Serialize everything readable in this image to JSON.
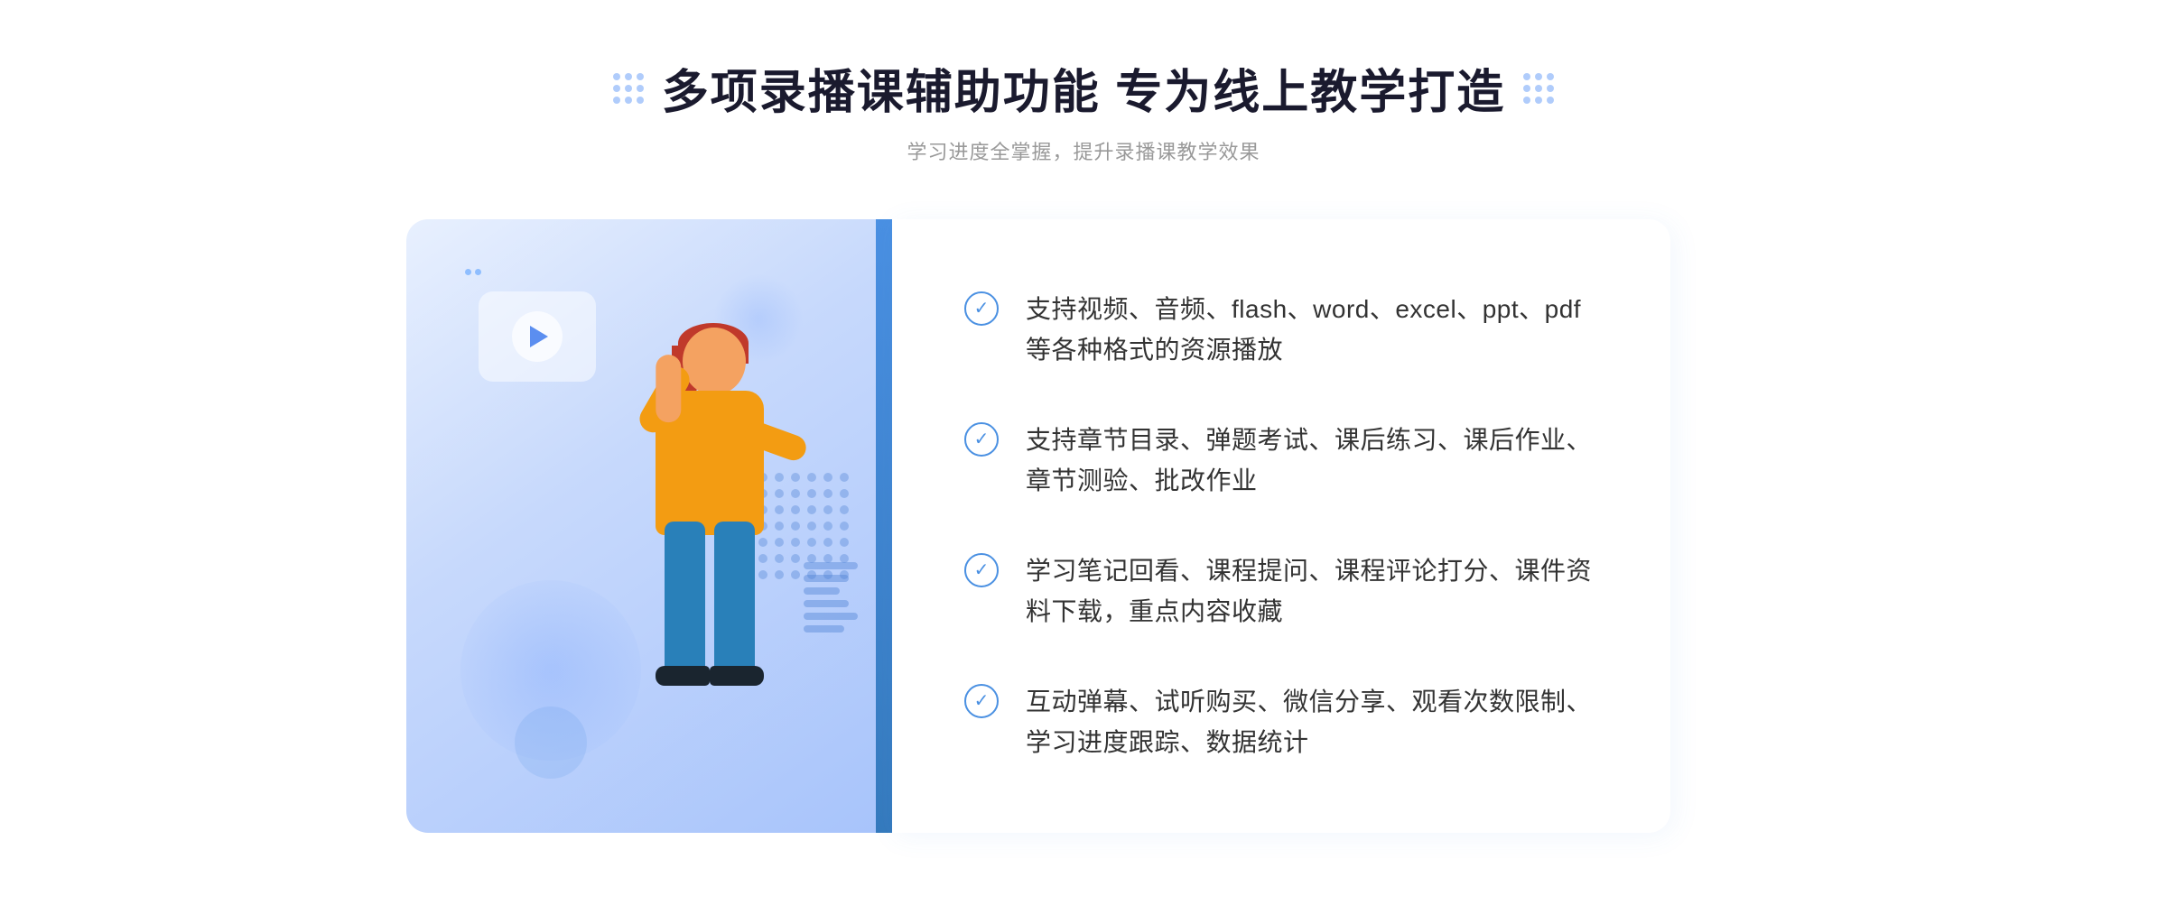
{
  "header": {
    "main_title": "多项录播课辅助功能 专为线上教学打造",
    "subtitle": "学习进度全掌握，提升录播课教学效果"
  },
  "features": [
    {
      "id": "feature-1",
      "text": "支持视频、音频、flash、word、excel、ppt、pdf等各种格式的资源播放"
    },
    {
      "id": "feature-2",
      "text": "支持章节目录、弹题考试、课后练习、课后作业、章节测验、批改作业"
    },
    {
      "id": "feature-3",
      "text": "学习笔记回看、课程提问、课程评论打分、课件资料下载，重点内容收藏"
    },
    {
      "id": "feature-4",
      "text": "互动弹幕、试听购买、微信分享、观看次数限制、学习进度跟踪、数据统计"
    }
  ],
  "decorations": {
    "left_chevron": "»",
    "dots_label": "decorative dots"
  }
}
